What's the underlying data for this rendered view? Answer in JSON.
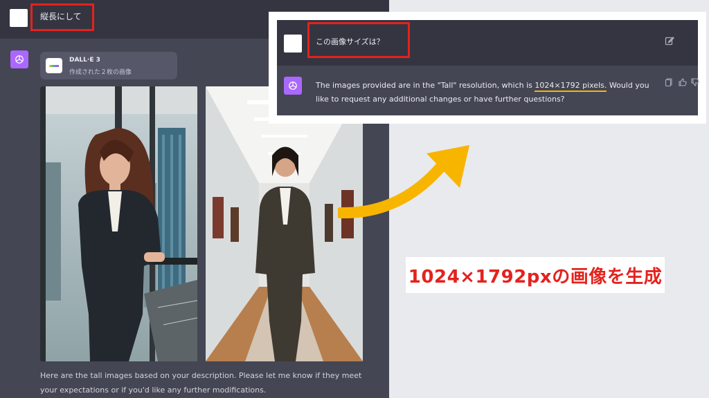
{
  "left_chat": {
    "user_message": "縦長にして",
    "dalle_card": {
      "name": "DALL·E 3",
      "subtitle": "作成された２枚の画像"
    },
    "reply": "Here are the tall images based on your description. Please let me know if they meet your expectations or if you'd like any further modifications."
  },
  "callout": {
    "question": "この画像サイズは？",
    "answer_before": "The images provided are in the \"Tall\" resolution, which is ",
    "answer_highlight": "1024×1792 pixels.",
    "answer_after": " Would you like to request any additional changes or have further questions?",
    "icons": [
      "edit-icon",
      "copy-icon",
      "thumbs-up-icon",
      "thumbs-down-icon"
    ]
  },
  "caption": "1024×1792pxの画像を生成",
  "colors": {
    "chat_bg": "#343541",
    "assistant_bg": "#444654",
    "highlight_red": "#e4221e",
    "underline_yellow": "#f5b800",
    "arrow_yellow": "#f7b500",
    "gpt_purple": "#ab68ff"
  }
}
